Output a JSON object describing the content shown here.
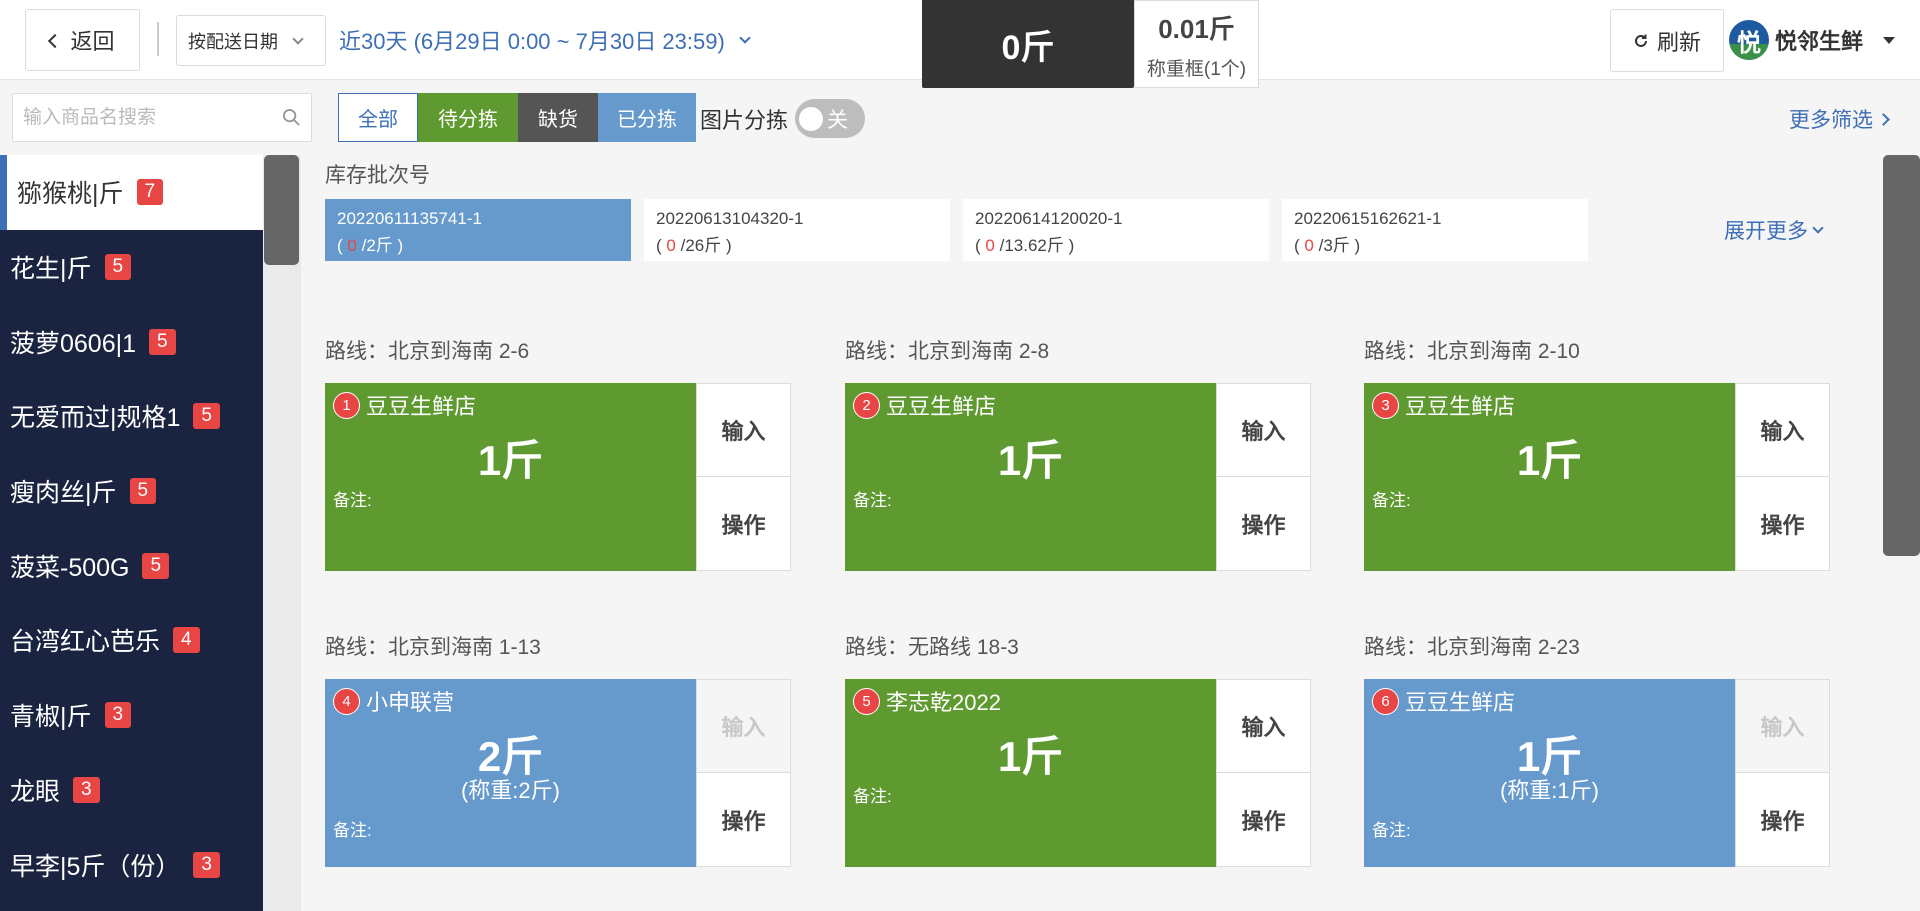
{
  "header": {
    "back_label": "返回",
    "date_mode": "按配送日期",
    "date_range": "近30天 (6月29日 0:00 ~ 7月30日 23:59)",
    "current_weight": "0斤",
    "frame_weight": "0.01斤",
    "frame_label": "称重框(1个)",
    "refresh_label": "刷新",
    "brand_logo_char": "悦",
    "brand_name": "悦邻生鲜"
  },
  "search": {
    "placeholder": "输入商品名搜索"
  },
  "sidebar": {
    "items": [
      {
        "label": "猕猴桃|斤",
        "count": "7"
      },
      {
        "label": "花生|斤",
        "count": "5"
      },
      {
        "label": "菠萝0606|1",
        "count": "5"
      },
      {
        "label": "无爱而过|规格1",
        "count": "5"
      },
      {
        "label": "瘦肉丝|斤",
        "count": "5"
      },
      {
        "label": "菠菜-500G",
        "count": "5"
      },
      {
        "label": "台湾红心芭乐",
        "count": "4"
      },
      {
        "label": "青椒|斤",
        "count": "3"
      },
      {
        "label": "龙眼",
        "count": "3"
      },
      {
        "label": "早李|5斤（份）",
        "count": "3"
      }
    ]
  },
  "filters": {
    "all": "全部",
    "pending": "待分拣",
    "shortage": "缺货",
    "done": "已分拣",
    "image_sort_label": "图片分拣",
    "image_sort_state": "关",
    "more_filters": "更多筛选"
  },
  "batch": {
    "title": "库存批次号",
    "expand_more": "展开更多",
    "items": [
      {
        "code": "20220611135741-1",
        "sorted": "0",
        "total": "/2斤 )"
      },
      {
        "code": "20220613104320-1",
        "sorted": "0",
        "total": "/26斤 )"
      },
      {
        "code": "20220614120020-1",
        "sorted": "0",
        "total": "/13.62斤 )"
      },
      {
        "code": "20220615162621-1",
        "sorted": "0",
        "total": "/3斤 )"
      }
    ]
  },
  "cards": [
    {
      "route": "路线：北京到海南 2-6",
      "num": "1",
      "store": "豆豆生鲜店",
      "qty": "1斤",
      "weigh": "",
      "remark": "备注:",
      "input_label": "输入",
      "op_label": "操作"
    },
    {
      "route": "路线：北京到海南 2-8",
      "num": "2",
      "store": "豆豆生鲜店",
      "qty": "1斤",
      "weigh": "",
      "remark": "备注:",
      "input_label": "输入",
      "op_label": "操作"
    },
    {
      "route": "路线：北京到海南 2-10",
      "num": "3",
      "store": "豆豆生鲜店",
      "qty": "1斤",
      "weigh": "",
      "remark": "备注:",
      "input_label": "输入",
      "op_label": "操作"
    },
    {
      "route": "路线：北京到海南 1-13",
      "num": "4",
      "store": "小申联营",
      "qty": "2斤",
      "weigh": "(称重:2斤)",
      "remark": "备注:",
      "input_label": "输入",
      "op_label": "操作"
    },
    {
      "route": "路线：无路线 18-3",
      "num": "5",
      "store": "李志乾2022",
      "qty": "1斤",
      "weigh": "",
      "remark": "备注:",
      "input_label": "输入",
      "op_label": "操作"
    },
    {
      "route": "路线：北京到海南 2-23",
      "num": "6",
      "store": "豆豆生鲜店",
      "qty": "1斤",
      "weigh": "(称重:1斤)",
      "remark": "备注:",
      "input_label": "输入",
      "op_label": "操作"
    }
  ],
  "colors": {
    "accent_blue": "#3e6fb6",
    "pending_green": "#5f9a31",
    "sorted_blue": "#6699cc",
    "shortage_gray": "#555555",
    "badge_red": "#e84545",
    "sidebar_navy": "#1a2440"
  }
}
